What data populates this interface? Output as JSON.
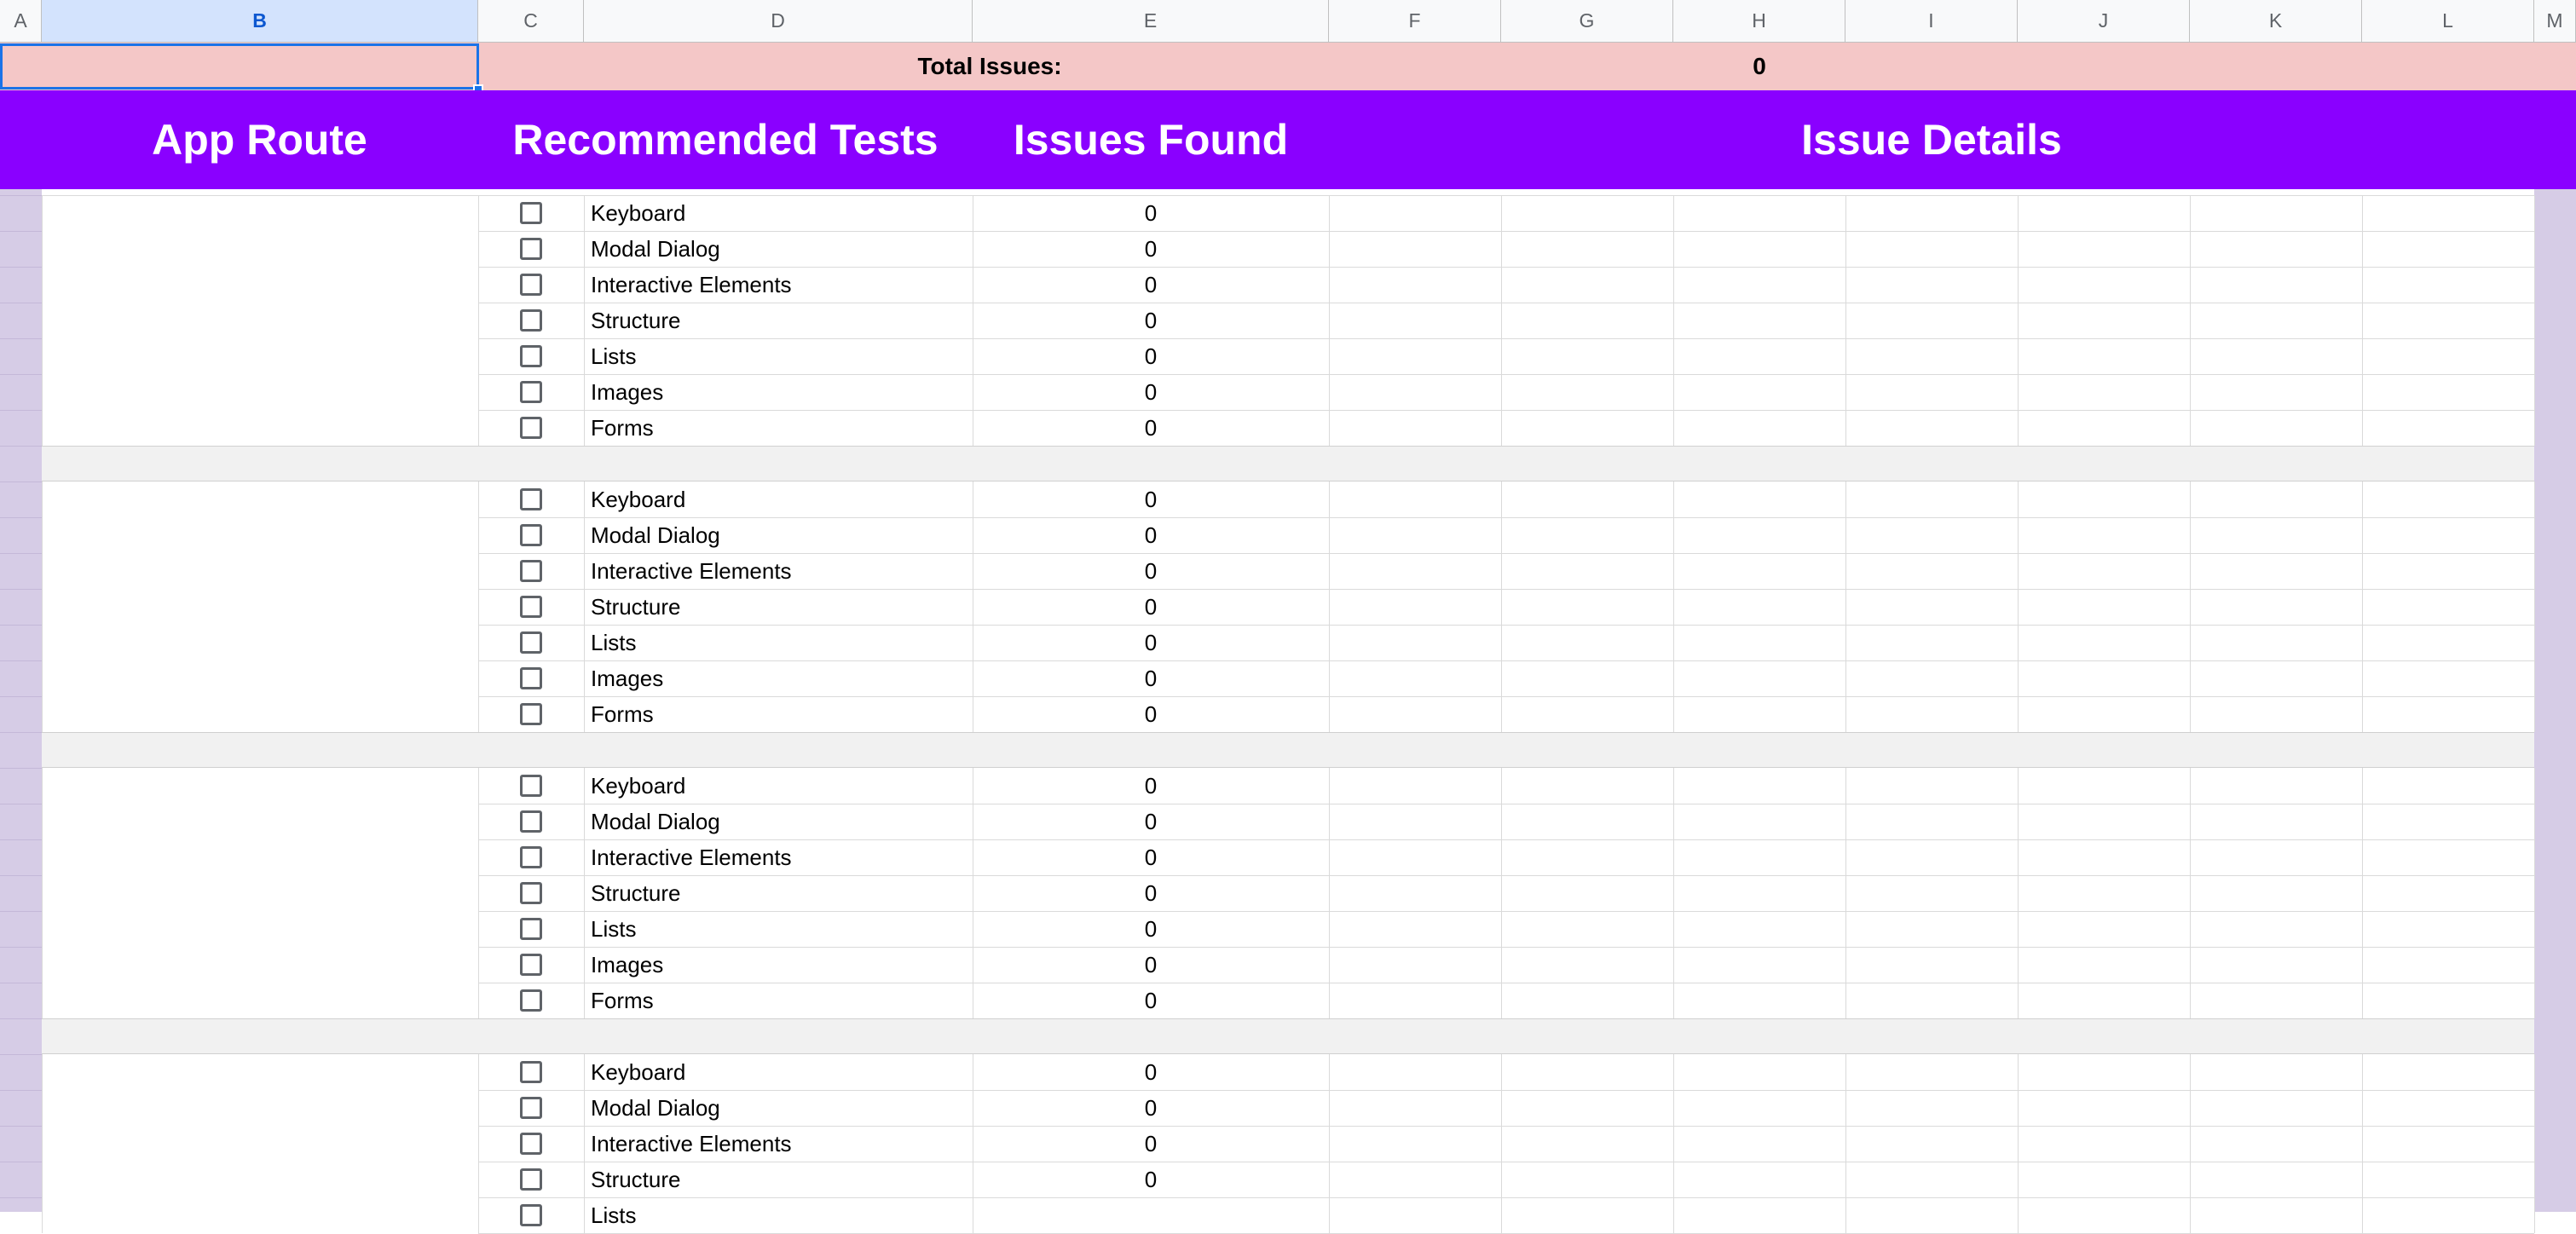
{
  "columns": [
    "A",
    "B",
    "C",
    "D",
    "E",
    "F",
    "G",
    "H",
    "I",
    "J",
    "K",
    "L",
    "M"
  ],
  "selected_column": "B",
  "totals": {
    "label": "Total Issues:",
    "value": "0"
  },
  "headers": {
    "app_route": "App Route",
    "recommended_tests": "Recommended Tests",
    "issues_found": "Issues Found",
    "issue_details": "Issue Details"
  },
  "route_groups": [
    {
      "tests": [
        {
          "name": "Keyboard",
          "issues": "0",
          "checked": false
        },
        {
          "name": "Modal Dialog",
          "issues": "0",
          "checked": false
        },
        {
          "name": "Interactive Elements",
          "issues": "0",
          "checked": false
        },
        {
          "name": "Structure",
          "issues": "0",
          "checked": false
        },
        {
          "name": "Lists",
          "issues": "0",
          "checked": false
        },
        {
          "name": "Images",
          "issues": "0",
          "checked": false
        },
        {
          "name": "Forms",
          "issues": "0",
          "checked": false
        }
      ]
    },
    {
      "tests": [
        {
          "name": "Keyboard",
          "issues": "0",
          "checked": false
        },
        {
          "name": "Modal Dialog",
          "issues": "0",
          "checked": false
        },
        {
          "name": "Interactive Elements",
          "issues": "0",
          "checked": false
        },
        {
          "name": "Structure",
          "issues": "0",
          "checked": false
        },
        {
          "name": "Lists",
          "issues": "0",
          "checked": false
        },
        {
          "name": "Images",
          "issues": "0",
          "checked": false
        },
        {
          "name": "Forms",
          "issues": "0",
          "checked": false
        }
      ]
    },
    {
      "tests": [
        {
          "name": "Keyboard",
          "issues": "0",
          "checked": false
        },
        {
          "name": "Modal Dialog",
          "issues": "0",
          "checked": false
        },
        {
          "name": "Interactive Elements",
          "issues": "0",
          "checked": false
        },
        {
          "name": "Structure",
          "issues": "0",
          "checked": false
        },
        {
          "name": "Lists",
          "issues": "0",
          "checked": false
        },
        {
          "name": "Images",
          "issues": "0",
          "checked": false
        },
        {
          "name": "Forms",
          "issues": "0",
          "checked": false
        }
      ]
    },
    {
      "tests": [
        {
          "name": "Keyboard",
          "issues": "0",
          "checked": false
        },
        {
          "name": "Modal Dialog",
          "issues": "0",
          "checked": false
        },
        {
          "name": "Interactive Elements",
          "issues": "0",
          "checked": false
        },
        {
          "name": "Structure",
          "issues": "0",
          "checked": false
        },
        {
          "name": "Lists",
          "issues": "",
          "checked": false
        }
      ]
    }
  ],
  "colors": {
    "header_bg": "#8a00ff",
    "totals_bg": "#f4c7c7",
    "row_strip": "#d6cce6",
    "selection": "#1a73e8"
  }
}
